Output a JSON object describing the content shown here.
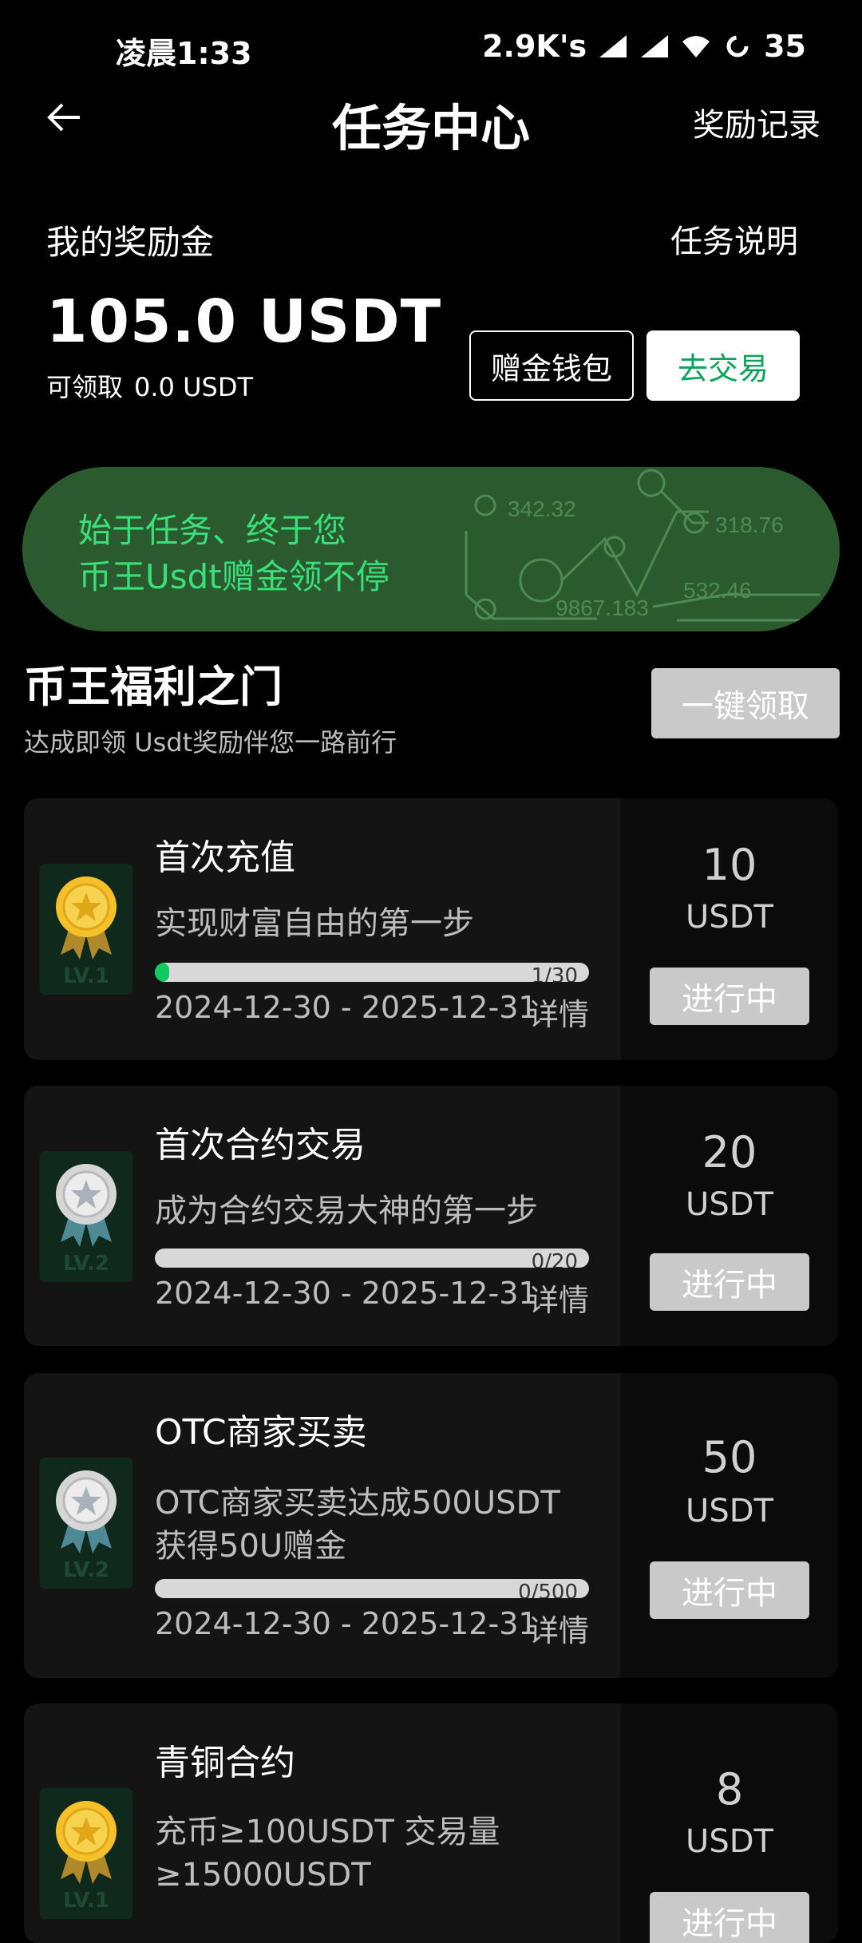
{
  "status": {
    "time": "凌晨1:33",
    "speed": "2.9K's",
    "battery": "35"
  },
  "header": {
    "title": "任务中心",
    "records": "奖励记录"
  },
  "reward": {
    "label": "我的奖励金",
    "explain": "任务说明",
    "amount": "105.0 USDT",
    "claimable_label": "可领取",
    "claimable_value": "0.0 USDT",
    "wallet_btn": "赠金钱包",
    "trade_btn": "去交易"
  },
  "banner": {
    "line1": "始于任务、终于您",
    "line2": "币王Usdt赠金领不停",
    "nums": [
      "342.32",
      "318.76",
      "9867.183",
      "532.46"
    ]
  },
  "section": {
    "title": "币王福利之门",
    "subtitle": "达成即领 Usdt奖励伴您一路前行",
    "claim_all": "一键领取"
  },
  "tasks": [
    {
      "title": "首次充值",
      "desc": "实现财富自由的第一步",
      "progress_text": "1/30",
      "progress": 0.033,
      "dates": "2024-12-30 - 2025-12-31",
      "detail": "详情",
      "reward": "10",
      "unit": "USDT",
      "status": "进行中",
      "badge": "gold",
      "level": "LV.1"
    },
    {
      "title": "首次合约交易",
      "desc": "成为合约交易大神的第一步",
      "progress_text": "0/20",
      "progress": 0,
      "dates": "2024-12-30 - 2025-12-31",
      "detail": "详情",
      "reward": "20",
      "unit": "USDT",
      "status": "进行中",
      "badge": "silver",
      "level": "LV.2"
    },
    {
      "title": "OTC商家买卖",
      "desc1": "OTC商家买卖达成500USDT",
      "desc2": "获得50U赠金",
      "progress_text": "0/500",
      "progress": 0,
      "dates": "2024-12-30 - 2025-12-31",
      "detail": "详情",
      "reward": "50",
      "unit": "USDT",
      "status": "进行中",
      "badge": "silver",
      "level": "LV.2"
    },
    {
      "title": "青铜合约",
      "desc1": "充币≥100USDT 交易量",
      "desc2": "≥15000USDT",
      "reward": "8",
      "unit": "USDT",
      "status": "进行中",
      "badge": "gold",
      "level": "LV.1"
    }
  ],
  "colors": {
    "accent": "#0ba35a",
    "banner_bg": "#2c5a2f",
    "banner_text": "#39e07a",
    "progress_fill": "#10c95f",
    "gold": "#f5c02a",
    "silver": "#d6d6d6"
  }
}
